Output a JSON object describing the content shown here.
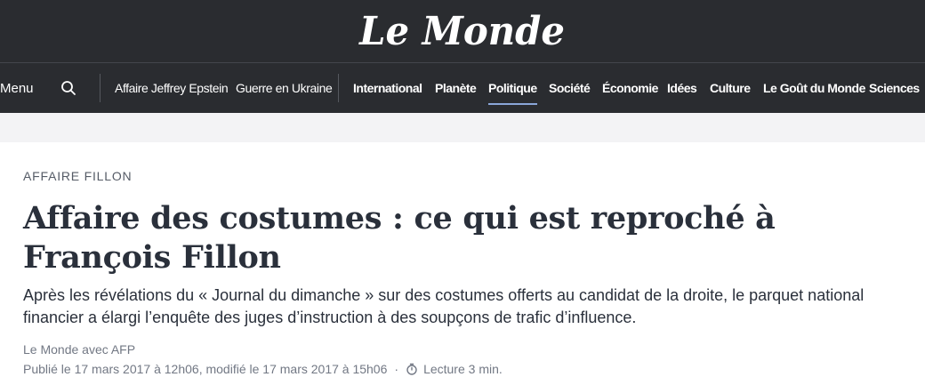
{
  "header": {
    "logo": "Le Monde",
    "menu_label": "Menu",
    "search_icon": "search-icon",
    "trending": [
      "Affaire Jeffrey Epstein",
      "Guerre en Ukraine"
    ],
    "sections": [
      "International",
      "Planète",
      "Politique",
      "Société",
      "Économie",
      "Idées",
      "Culture",
      "Le Goût du Monde",
      "Sciences"
    ],
    "active_section": "Politique"
  },
  "article": {
    "kicker": "AFFAIRE FILLON",
    "title": "Affaire des costumes : ce qui est reproché à François Fillon",
    "description": "Après les révélations du « Journal du dimanche » sur des costumes offerts au candidat de la droite, le parquet national financier a élargi l’enquête des juges d’instruction à des soupçons de trafic d’influence.",
    "author": "Le Monde avec AFP",
    "published": "Publié le 17 mars 2017 à 12h06, modifié le 17 mars 2017 à 15h06",
    "separator": "·",
    "reading_icon": "timer-icon",
    "reading_time": "Lecture 3 min."
  },
  "colors": {
    "topbar": "#2a2c30",
    "active_underline": "#8aa6d8",
    "band": "#f3f3f5"
  }
}
